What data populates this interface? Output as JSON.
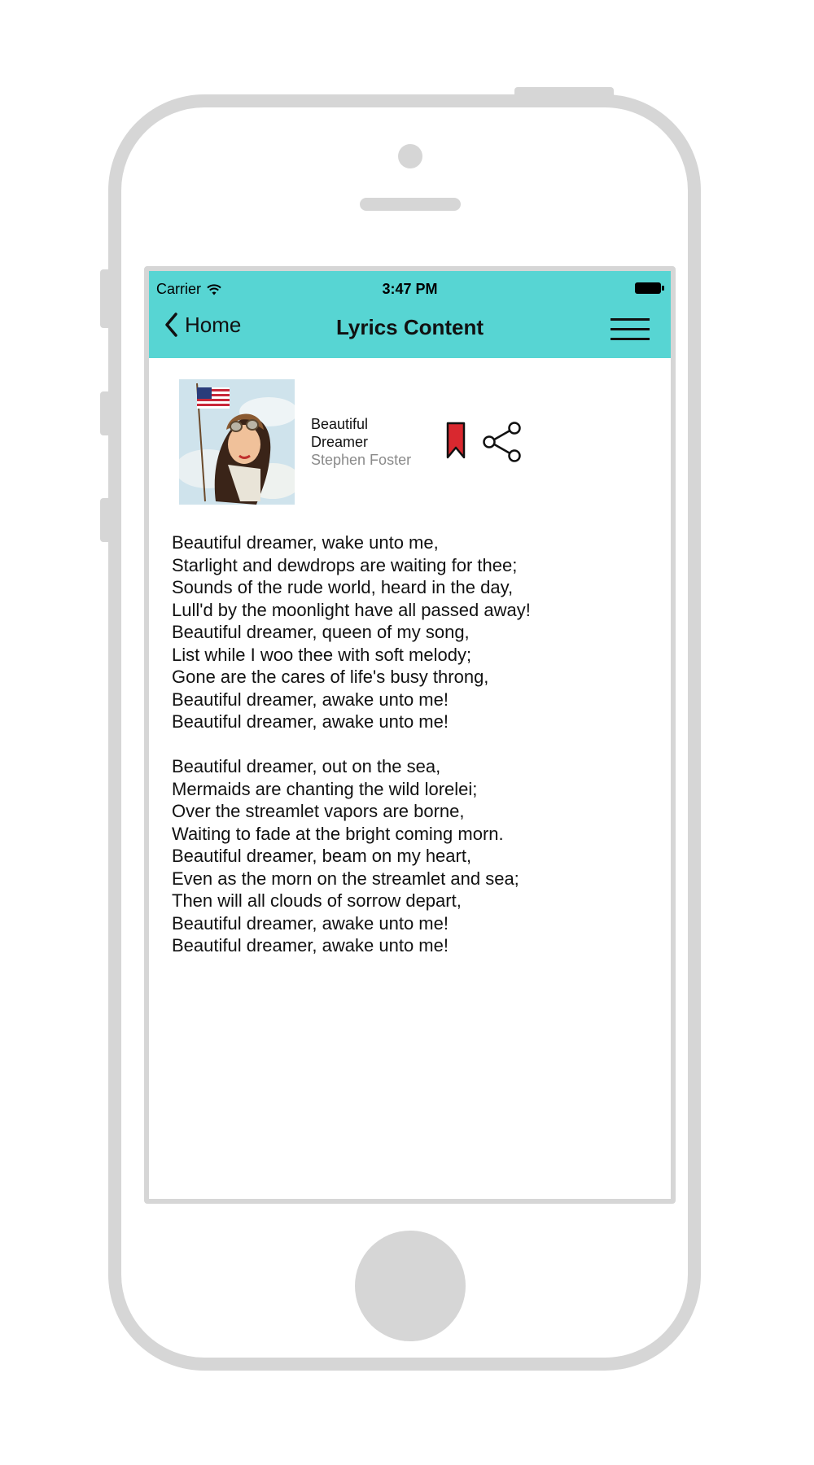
{
  "status_bar": {
    "carrier": "Carrier",
    "time": "3:47 PM",
    "icons": [
      "wifi-icon",
      "battery-icon"
    ]
  },
  "nav_bar": {
    "back_label": "Home",
    "title": "Lyrics Content",
    "background_color": "#57d5d3",
    "icons": [
      "chevron-left-icon",
      "hamburger-menu-icon"
    ]
  },
  "song": {
    "title_line1": "Beautiful",
    "title_line2": "Dreamer",
    "artist": "Stephen Foster",
    "actions": [
      "bookmark-icon",
      "share-icon"
    ],
    "bookmark_color": "#d9282f"
  },
  "lyrics": {
    "stanza1": [
      "Beautiful dreamer, wake unto me,",
      "Starlight and dewdrops are waiting for thee;",
      "Sounds of the rude world, heard in the day,",
      "Lull'd by the moonlight have all passed away!",
      "Beautiful dreamer, queen of my song,",
      "List while I woo thee with soft melody;",
      "Gone are the cares of life's busy throng,",
      "Beautiful dreamer, awake unto me!",
      "Beautiful dreamer, awake unto me!"
    ],
    "stanza2": [
      "Beautiful dreamer, out on the sea,",
      "Mermaids are chanting the wild lorelei;",
      "Over the streamlet vapors are borne,",
      "Waiting to fade at the bright coming morn.",
      "Beautiful dreamer, beam on my heart,",
      "Even as the morn on the streamlet and sea;",
      "Then will all clouds of sorrow depart,",
      "Beautiful dreamer, awake unto me!",
      "Beautiful dreamer, awake unto me!"
    ]
  }
}
